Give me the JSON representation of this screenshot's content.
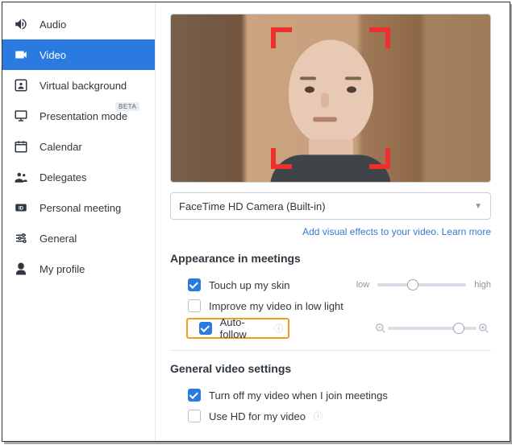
{
  "sidebar": {
    "items": [
      {
        "label": "Audio"
      },
      {
        "label": "Video"
      },
      {
        "label": "Virtual background"
      },
      {
        "label": "Presentation mode",
        "badge": "BETA"
      },
      {
        "label": "Calendar"
      },
      {
        "label": "Delegates"
      },
      {
        "label": "Personal meeting"
      },
      {
        "label": "General"
      },
      {
        "label": "My profile"
      }
    ]
  },
  "camera": {
    "selected": "FaceTime HD Camera (Built-in)"
  },
  "links": {
    "effects": "Add visual effects to your video. Learn more"
  },
  "appearance": {
    "title": "Appearance in meetings",
    "touch_up": "Touch up my skin",
    "low_light": "Improve my video in low light",
    "auto_follow": "Auto-follow",
    "slider_low": "low",
    "slider_high": "high"
  },
  "general": {
    "title": "General video settings",
    "turn_off": "Turn off my video when I join meetings",
    "use_hd": "Use HD for my video"
  }
}
